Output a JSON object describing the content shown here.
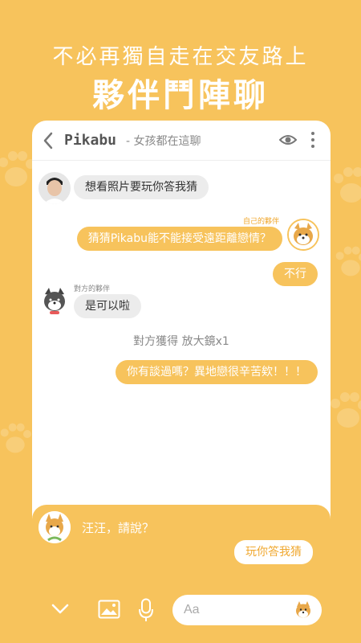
{
  "promo": {
    "tagline": "不必再獨自走在交友路上",
    "headline": "夥伴鬥陣聊"
  },
  "header": {
    "name": "Pikabu",
    "subtitle": "- 女孩都在這聊",
    "icons": [
      "back-arrow-icon",
      "eye-icon",
      "more-vertical-icon"
    ]
  },
  "messages": {
    "m1": "想看照片要玩你答我猜",
    "my_partner_label": "自己的夥伴",
    "m2": "猜猜Pikabu能不能接受遠距離戀情？",
    "m3": "不行",
    "their_partner_label": "對方的夥伴",
    "m4": "是可以啦",
    "system": "對方獲得  放大鏡x1",
    "m5": "你有談過嗎？異地戀很辛苦欸！！！"
  },
  "panel": {
    "prompt": "汪汪，請說？",
    "quick_reply": "玩你答我猜",
    "input_placeholder": "Aa",
    "icons": [
      "chevron-down-icon",
      "image-icon",
      "microphone-icon",
      "dog-emoji-icon"
    ]
  },
  "colors": {
    "brand": "#F7C35C",
    "accent_text": "#F0A830",
    "incoming_bubble": "#ECECEC"
  }
}
